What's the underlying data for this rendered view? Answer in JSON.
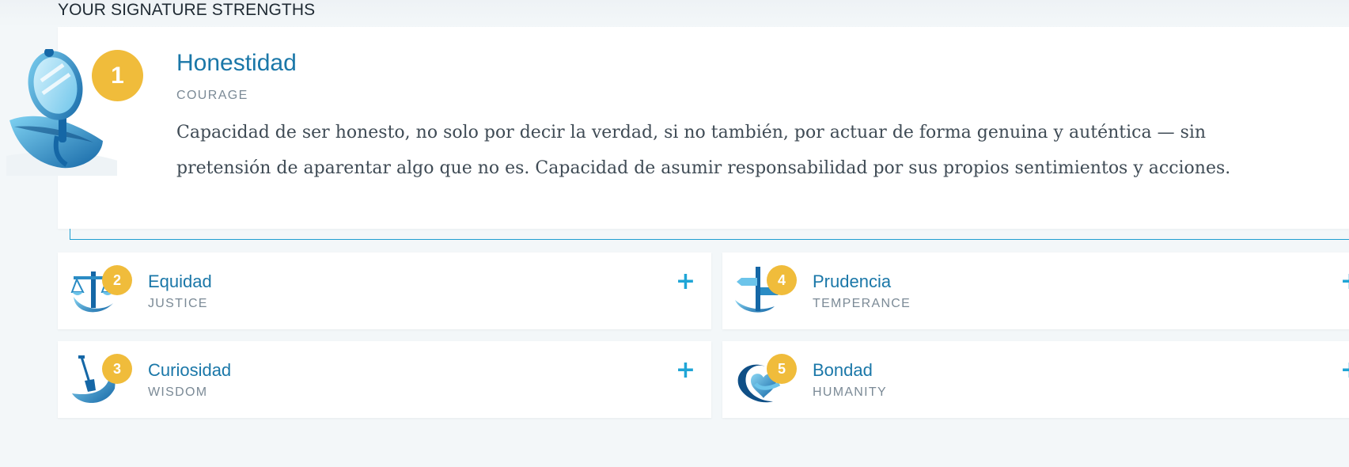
{
  "section": {
    "title": "YOUR SIGNATURE STRENGTHS"
  },
  "top_strength": {
    "rank": "1",
    "name": "Honestidad",
    "virtue": "COURAGE",
    "description": "Capacidad de ser honesto, no solo por decir la verdad, si no también, por actuar de forma genuina y auténtica — sin pretensión de aparentar algo que no es. Capacidad de asumir responsabilidad por sus propios sentimientos y acciones.",
    "icon": "mirror-icon"
  },
  "strengths": [
    {
      "rank": "2",
      "name": "Equidad",
      "virtue": "JUSTICE",
      "expand": "+",
      "icon": "scales-icon"
    },
    {
      "rank": "3",
      "name": "Curiosidad",
      "virtue": "WISDOM",
      "expand": "+",
      "icon": "shovel-icon"
    },
    {
      "rank": "4",
      "name": "Prudencia",
      "virtue": "TEMPERANCE",
      "expand": "+",
      "icon": "signpost-icon"
    },
    {
      "rank": "5",
      "name": "Bondad",
      "virtue": "HUMANITY",
      "expand": "+",
      "icon": "heart-icon"
    }
  ],
  "colors": {
    "accent": "#1a77a8",
    "badge": "#f0bc3b",
    "plus": "#1fa5d6",
    "background": "#f3f7f9"
  }
}
